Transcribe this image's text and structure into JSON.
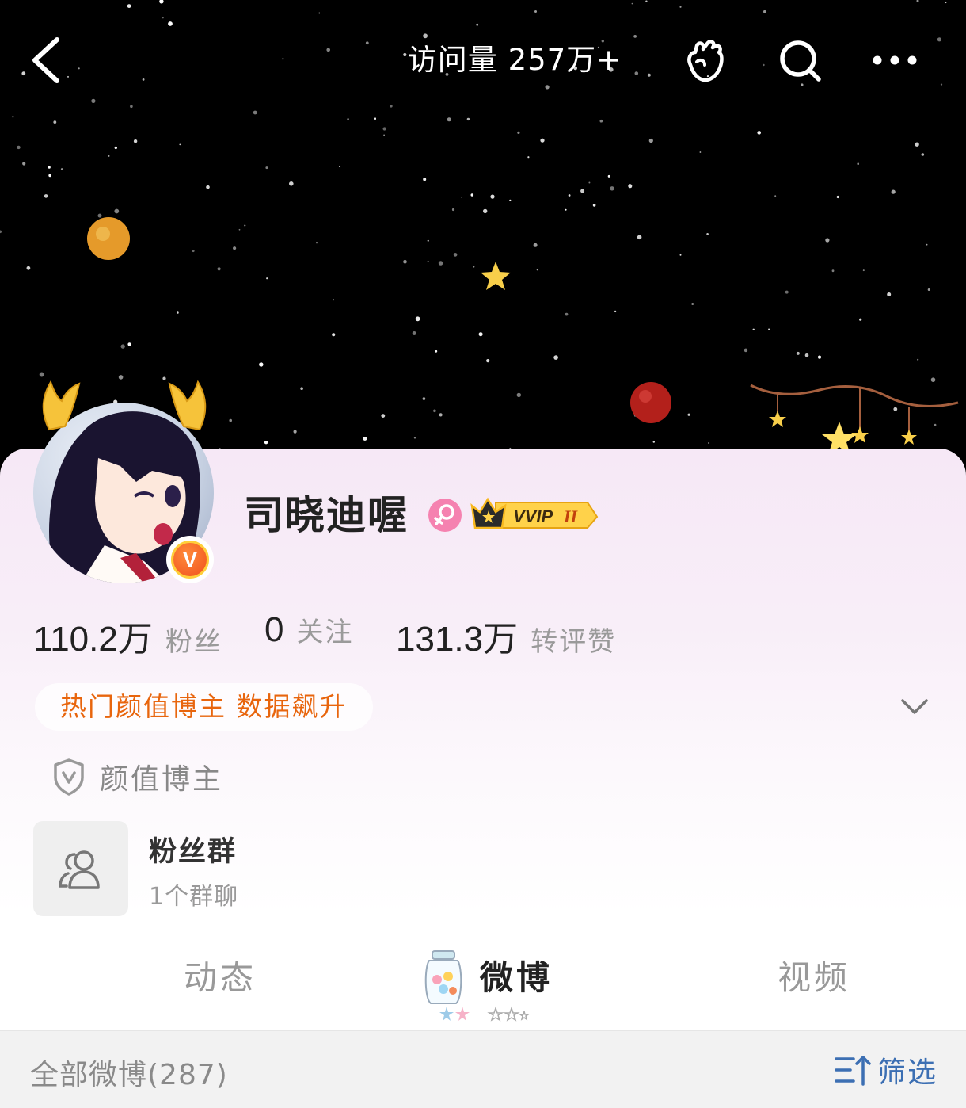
{
  "header": {
    "visit_label": "访问量",
    "visit_count": "257万+"
  },
  "profile": {
    "nickname": "司晓迪喔",
    "vip_label": "VVIP",
    "vip_level": "II",
    "verified_mark": "V"
  },
  "stats": [
    {
      "value": "110.2万",
      "label": "粉丝"
    },
    {
      "value": "0",
      "label": "关注"
    },
    {
      "value": "131.3万",
      "label": "转评赞"
    }
  ],
  "hot_tag": "热门颜值博主 数据飙升",
  "category": "颜值博主",
  "fan_group": {
    "title": "粉丝群",
    "subtitle": "1个群聊"
  },
  "tabs": [
    {
      "label": "动态",
      "active": false
    },
    {
      "label": "微博",
      "active": true
    },
    {
      "label": "视频",
      "active": false
    }
  ],
  "filter_bar": {
    "all_label": "全部微博(287)",
    "filter_label": "筛选"
  },
  "colors": {
    "accent_orange": "#e8650d",
    "link_blue": "#3c6fb3",
    "card_pink": "#f6e8f6",
    "vip_gold": "#f7b81f"
  },
  "icons": [
    "back-arrow-icon",
    "cheer-hand-icon",
    "search-icon",
    "more-dots-icon",
    "female-icon",
    "vip-crown-icon",
    "chevron-down-icon",
    "shield-v-icon",
    "group-people-icon",
    "candy-jar-icon",
    "filter-sort-icon"
  ]
}
